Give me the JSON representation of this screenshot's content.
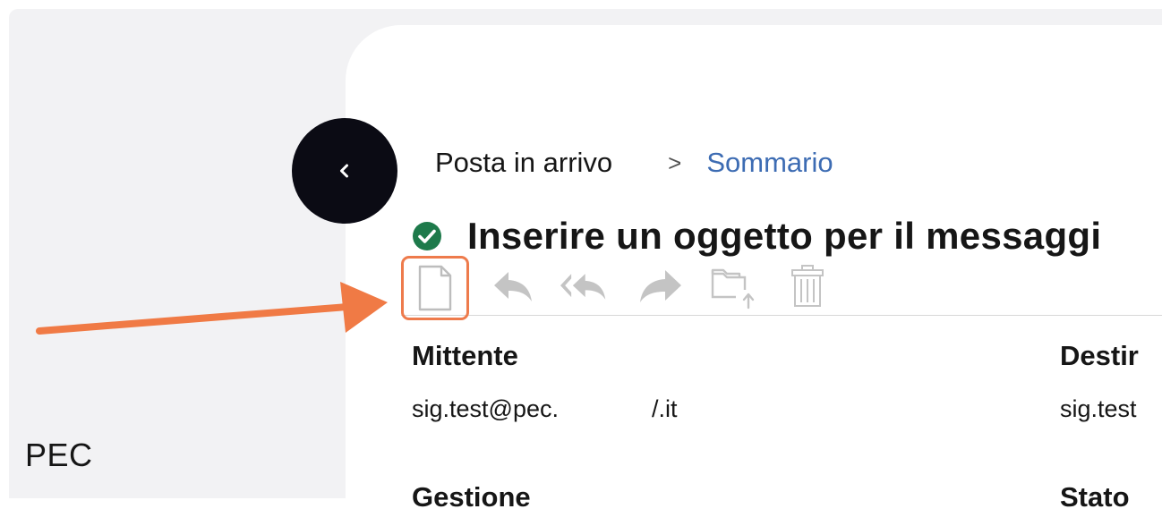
{
  "sidebar": {
    "label": "PEC"
  },
  "breadcrumb": {
    "home": "Posta in arrivo",
    "separator": ">",
    "current": "Sommario"
  },
  "message": {
    "status_icon": "check-circle-icon",
    "subject": "Inserire un oggetto per il messaggi",
    "fields": {
      "sender_label": "Mittente",
      "sender_value": "sig.test@pec.",
      "sender_value_tail": "/.it",
      "recipient_label": "Destir",
      "recipient_value": "sig.test",
      "management_label": "Gestione",
      "state_label": "Stato"
    }
  },
  "toolbar": {
    "buttons": [
      "document-icon",
      "reply-icon",
      "reply-all-icon",
      "forward-icon",
      "move-folder-icon",
      "trash-icon"
    ]
  },
  "colors": {
    "accent": "#ee7b4c",
    "link": "#3d6cb3",
    "success": "#1e7a4b",
    "back_button": "#0b0b14",
    "disabled_icon": "#c4c4c4",
    "background": "#f2f2f4"
  }
}
